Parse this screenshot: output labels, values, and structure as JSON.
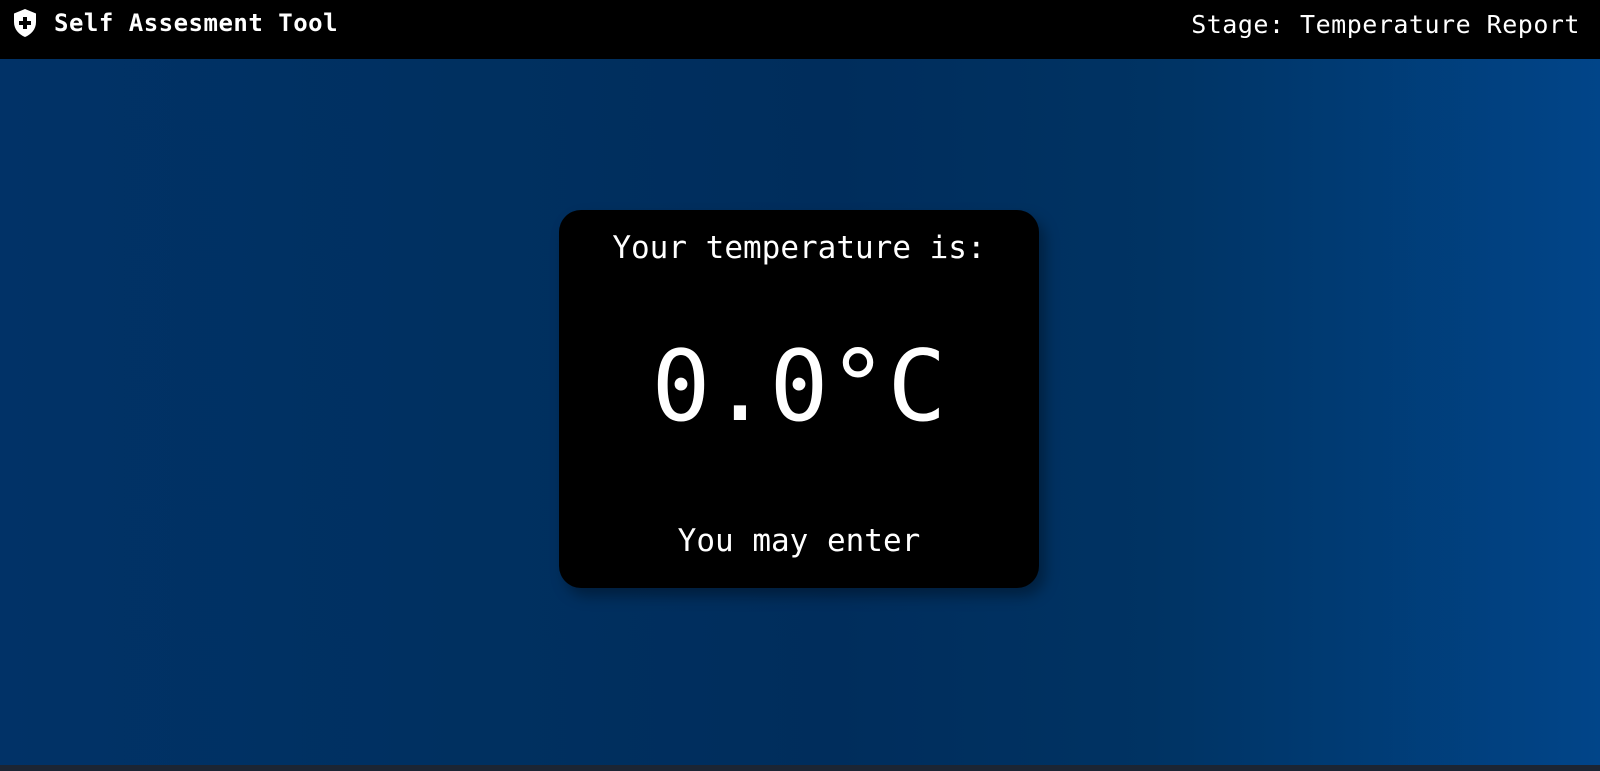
{
  "header": {
    "app_title": "Self Assesment Tool",
    "logo_icon": "shield-plus-icon",
    "stage_text": "Stage: Temperature Report"
  },
  "card": {
    "heading": "Your temperature is:",
    "temperature": "0.0°C",
    "status": "You may enter"
  },
  "colors": {
    "header_bg": "#000000",
    "card_bg": "#000000",
    "text": "#ffffff",
    "page_gradient_start": "#013267",
    "page_gradient_mid": "#002d5c",
    "page_gradient_end": "#014589"
  }
}
